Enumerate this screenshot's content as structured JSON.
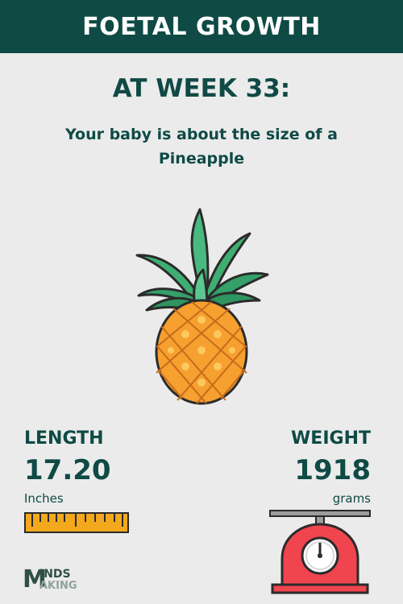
{
  "header": {
    "title": "FOETAL GROWTH"
  },
  "week": {
    "title": "AT WEEK 33:"
  },
  "description": {
    "text": "Your baby is about the size of a Pineapple"
  },
  "fruit": {
    "icon": "pineapple-icon"
  },
  "length": {
    "label": "LENGTH",
    "value": "17.20",
    "unit": "Inches",
    "icon": "ruler-icon"
  },
  "weight": {
    "label": "WEIGHT",
    "value": "1918",
    "unit": "grams",
    "icon": "scale-icon"
  },
  "logo": {
    "letter": "M",
    "top": "INDS",
    "bottom": "AKING"
  },
  "colors": {
    "primary": "#0f4a45",
    "background": "#ebebeb",
    "accent_yellow": "#f4a81d",
    "accent_red": "#f0444f"
  }
}
